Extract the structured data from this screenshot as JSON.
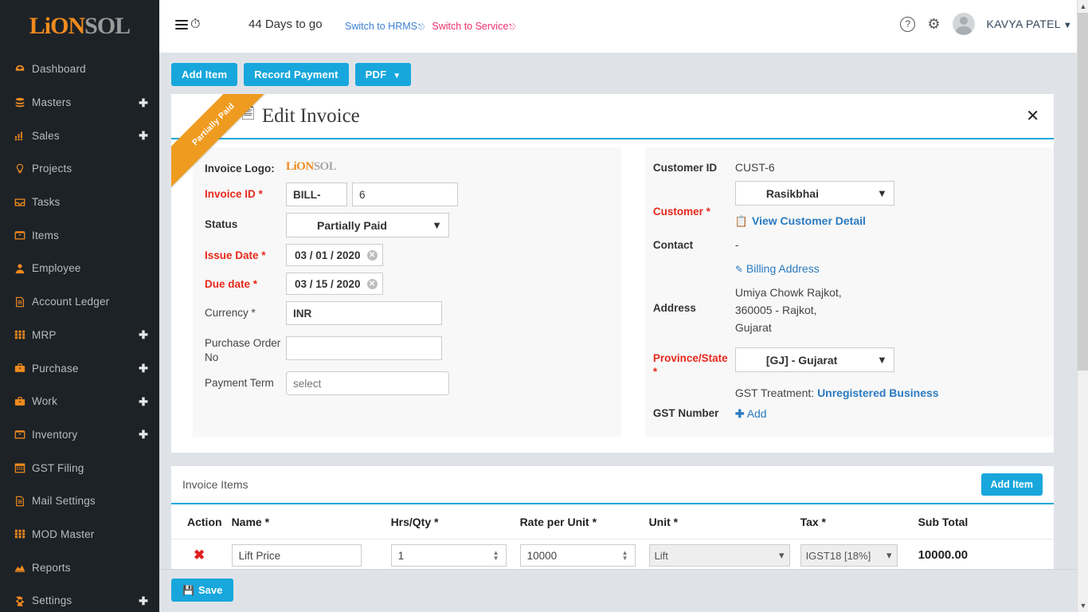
{
  "brand": {
    "name_orange": "LiON",
    "name_grey": "SOL",
    "full": "LIONSOL"
  },
  "sidebar": {
    "items": [
      {
        "label": "Dashboard",
        "icon": "dashboard-icon",
        "expandable": false
      },
      {
        "label": "Masters",
        "icon": "database-icon",
        "expandable": true
      },
      {
        "label": "Sales",
        "icon": "chart-bars-icon",
        "expandable": true
      },
      {
        "label": "Projects",
        "icon": "lightbulb-icon",
        "expandable": false
      },
      {
        "label": "Tasks",
        "icon": "inbox-icon",
        "expandable": false
      },
      {
        "label": "Items",
        "icon": "box-icon",
        "expandable": false
      },
      {
        "label": "Employee",
        "icon": "user-icon",
        "expandable": false
      },
      {
        "label": "Account Ledger",
        "icon": "file-text-icon",
        "expandable": false
      },
      {
        "label": "MRP",
        "icon": "grid-icon",
        "expandable": true
      },
      {
        "label": "Purchase",
        "icon": "briefcase-icon",
        "expandable": true
      },
      {
        "label": "Work",
        "icon": "briefcase-icon",
        "expandable": true
      },
      {
        "label": "Inventory",
        "icon": "box-icon",
        "expandable": true
      },
      {
        "label": "GST Filing",
        "icon": "calendar-icon",
        "expandable": false
      },
      {
        "label": "Mail Settings",
        "icon": "file-text-icon",
        "expandable": false
      },
      {
        "label": "MOD Master",
        "icon": "grid-icon",
        "expandable": false
      },
      {
        "label": "Reports",
        "icon": "area-chart-icon",
        "expandable": false
      },
      {
        "label": "Settings",
        "icon": "gear-icon",
        "expandable": true
      }
    ]
  },
  "topbar": {
    "days_to_go": "44 Days to go",
    "switch_hrms": "Switch to HRMS",
    "switch_service": "Switch to Service",
    "username": "KAVYA PATEL",
    "help_glyph": "?",
    "gear_glyph": "⚙"
  },
  "toolbar": {
    "add_item": "Add Item",
    "record_payment": "Record Payment",
    "pdf": "PDF"
  },
  "card": {
    "ribbon": "Partially Paid",
    "title": "Edit Invoice",
    "close_glyph": "✕"
  },
  "form": {
    "invoice_logo_label": "Invoice Logo:",
    "invoice_id_label": "Invoice ID",
    "invoice_id_prefix": "BILL-",
    "invoice_id_number": "6",
    "status_label": "Status",
    "status_value": "Partially Paid",
    "issue_date_label": "Issue Date",
    "issue_date_value": "03 / 01 / 2020",
    "due_date_label": "Due date",
    "due_date_value": "03 / 15 / 2020",
    "currency_label": "Currency *",
    "currency_value": "INR",
    "po_label": "Purchase Order No",
    "po_value": "",
    "payment_term_label": "Payment Term",
    "payment_term_placeholder": "select"
  },
  "customer": {
    "customer_id_label": "Customer ID",
    "customer_id_value": "CUST-6",
    "customer_label": "Customer",
    "customer_value": "Rasikbhai",
    "view_customer_detail": "View Customer Detail",
    "contact_label": "Contact",
    "contact_value": "-",
    "billing_address_link": "Billing Address",
    "address_label": "Address",
    "address_line1": "Umiya Chowk Rajkot,",
    "address_line2": "360005 - Rajkot,",
    "address_line3": "Gujarat",
    "province_label": "Province/State",
    "province_value": "[GJ] - Gujarat",
    "gst_number_label": "GST Number",
    "gst_treatment_prefix": "GST Treatment:",
    "gst_treatment_value": "Unregistered Business",
    "add_link": "Add"
  },
  "items": {
    "section_title": "Invoice Items",
    "add_item_button": "Add Item",
    "columns": [
      "Action",
      "Name *",
      "Hrs/Qty *",
      "Rate per Unit *",
      "Unit *",
      "Tax *",
      "Sub Total"
    ],
    "rows": [
      {
        "name": "Lift Price",
        "qty": "1",
        "rate": "10000",
        "unit": "Lift",
        "tax": "IGST18 [18%]",
        "sub_total": "10000.00"
      }
    ]
  },
  "footer": {
    "save": "Save"
  },
  "colors": {
    "accent_blue": "#18a7dc",
    "sidebar_bg": "#1d2227",
    "brand_orange": "#f08a1e",
    "required_red": "#e8291c",
    "ribbon_orange": "#ef9b20",
    "link_blue": "#2a7ac0",
    "service_pink": "#ee2f6a"
  }
}
